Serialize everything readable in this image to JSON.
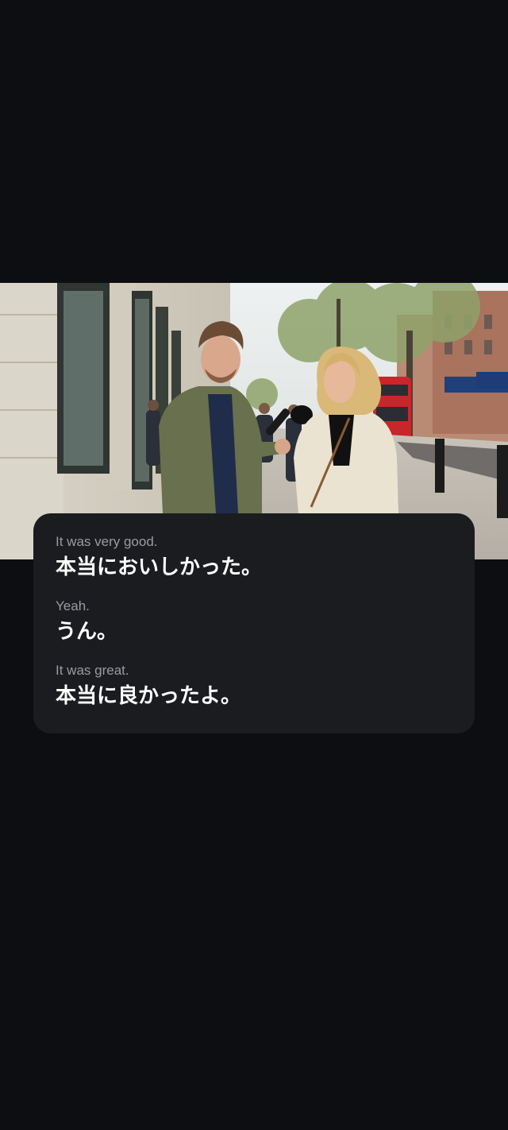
{
  "subtitles": [
    {
      "english": "It was very good.",
      "japanese": "本当においしかった。"
    },
    {
      "english": "Yeah.",
      "japanese": "うん。"
    },
    {
      "english": "It was great.",
      "japanese": "本当に良かったよ。"
    }
  ],
  "colors": {
    "background": "#0d0e12",
    "card": "#1b1c20",
    "english_text": "#9a9ba1",
    "japanese_text": "#ffffff"
  }
}
